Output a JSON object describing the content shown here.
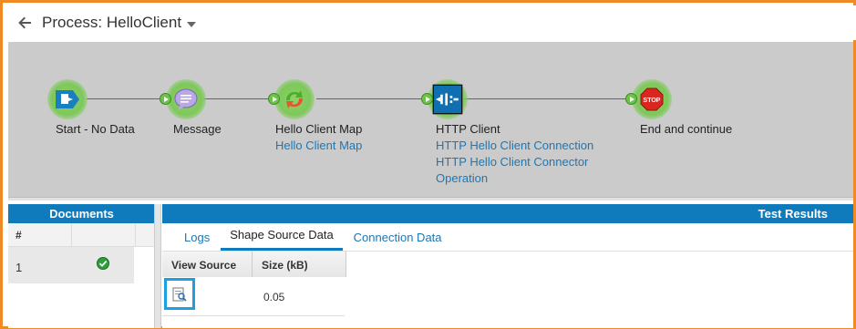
{
  "header": {
    "title": "Process: HelloClient"
  },
  "process": {
    "shapes": [
      {
        "label": "Start - No Data",
        "links": []
      },
      {
        "label": "Message",
        "links": []
      },
      {
        "label": "Hello Client Map",
        "links": [
          "Hello Client Map"
        ]
      },
      {
        "label": "HTTP Client",
        "links": [
          "HTTP Hello Client Connection",
          "HTTP Hello Client Connector",
          "Operation"
        ]
      },
      {
        "label": "End and continue",
        "links": []
      }
    ]
  },
  "documents": {
    "title": "Documents",
    "columns": [
      "#",
      ""
    ],
    "rows": [
      {
        "num": "1",
        "status": "success"
      }
    ]
  },
  "results": {
    "title": "Test Results",
    "tabs": [
      "Logs",
      "Shape Source Data",
      "Connection Data"
    ],
    "active_tab": "Shape Source Data",
    "columns": [
      "View Source",
      "Size (kB)"
    ],
    "rows": [
      {
        "size": "0.05"
      }
    ]
  },
  "colors": {
    "accent": "#0f7bbd",
    "link": "#1b78b5",
    "frame": "#f08a24",
    "highlight": "#1ba1e2",
    "canvas": "#cbcbcb"
  },
  "icons": {
    "back": "arrow-left-icon",
    "start": "start-no-data-icon",
    "message": "message-icon",
    "map": "map-icon",
    "http": "http-client-icon",
    "stop": "stop-icon",
    "success": "check-circle-icon",
    "view": "view-source-icon"
  }
}
